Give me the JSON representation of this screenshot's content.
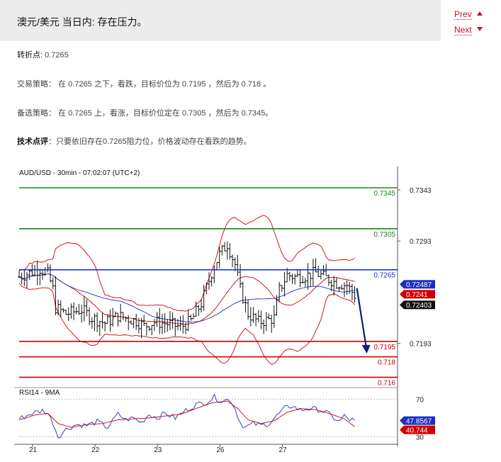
{
  "header": {
    "title": "澳元/美元 当日内: 存在压力。",
    "prev_label": "Prev",
    "next_label": "Next"
  },
  "content": {
    "pivot_label": "转折点:",
    "pivot_value": "0.7265",
    "strategy_label": "交易策略：",
    "strategy_text": "在 0.7265 之下，看跌，目标价位为 0.7195 ，然后为 0.718 。",
    "alt_label": "备选策略：",
    "alt_text": "在 0.7265 上，看涨，目标价位定在 0.7305 ，然后为 0.7345。",
    "comment_label": "技术点评",
    "comment_text": "：只要依旧存在0.7265阻力位，价格波动存在看跌的趋势。"
  },
  "chart_data": [
    {
      "type": "candlestick",
      "title": "AUD/USD - 30min - 07:02:07 (UTC+2)",
      "ylim": [
        0.7152,
        0.7354
      ],
      "y_ticks": [
        "0.7343",
        "0.7293",
        "0.7193"
      ],
      "x_ticks": [
        "21",
        "22",
        "23",
        "26",
        "27"
      ],
      "horizontal_levels": [
        {
          "label": "0.7345",
          "value": 0.7345,
          "color": "#1a8a1a"
        },
        {
          "label": "0.7305",
          "value": 0.7305,
          "color": "#1a8a1a"
        },
        {
          "label": "0.7265",
          "value": 0.7265,
          "color": "#1b2fc4"
        },
        {
          "label": "0.7195",
          "value": 0.7195,
          "color": "#d10000"
        },
        {
          "label": "0.718",
          "value": 0.718,
          "color": "#d10000"
        },
        {
          "label": "0.716",
          "value": 0.716,
          "color": "#d10000"
        }
      ],
      "value_tags": [
        {
          "label": "0.72487",
          "value": 0.72487,
          "color": "#1b2fc4"
        },
        {
          "label": "0.7241",
          "value": 0.72413,
          "color": "#d10000"
        },
        {
          "label": "0.72403",
          "value": 0.72403,
          "color": "#111111"
        }
      ],
      "close_path": [
        [
          0,
          0.7258
        ],
        [
          4,
          0.7262
        ],
        [
          8,
          0.7266
        ],
        [
          11,
          0.7261
        ],
        [
          13,
          0.7246
        ],
        [
          14,
          0.7228
        ],
        [
          18,
          0.7222
        ],
        [
          24,
          0.7226
        ],
        [
          28,
          0.7218
        ],
        [
          33,
          0.7213
        ],
        [
          38,
          0.722
        ],
        [
          45,
          0.7215
        ],
        [
          48,
          0.721
        ],
        [
          52,
          0.7214
        ],
        [
          58,
          0.7212
        ],
        [
          62,
          0.7209
        ],
        [
          66,
          0.7215
        ],
        [
          70,
          0.7232
        ],
        [
          74,
          0.7262
        ],
        [
          77,
          0.728
        ],
        [
          80,
          0.729
        ],
        [
          83,
          0.727
        ],
        [
          85,
          0.7246
        ],
        [
          88,
          0.7222
        ],
        [
          92,
          0.7214
        ],
        [
          96,
          0.7216
        ],
        [
          98,
          0.7218
        ],
        [
          100,
          0.7245
        ],
        [
          103,
          0.726
        ],
        [
          106,
          0.7258
        ],
        [
          110,
          0.7259
        ],
        [
          114,
          0.7262
        ],
        [
          118,
          0.7257
        ],
        [
          122,
          0.7252
        ],
        [
          126,
          0.725
        ],
        [
          129,
          0.724
        ]
      ],
      "forecast": {
        "from": 0.7247,
        "to": 0.7186
      }
    },
    {
      "type": "line",
      "title": "RSI14 - 9MA",
      "ylim": [
        25,
        80
      ],
      "y_ticks": [
        "70",
        "30"
      ],
      "series": [
        {
          "name": "RSI14",
          "color": "#1b2fc4",
          "points": [
            [
              0,
              49
            ],
            [
              5,
              55
            ],
            [
              9,
              58
            ],
            [
              11,
              55
            ],
            [
              13,
              45
            ],
            [
              15,
              30
            ],
            [
              18,
              38
            ],
            [
              22,
              43
            ],
            [
              26,
              42
            ],
            [
              30,
              46
            ],
            [
              34,
              40
            ],
            [
              38,
              54
            ],
            [
              41,
              48
            ],
            [
              44,
              50
            ],
            [
              47,
              45
            ],
            [
              50,
              54
            ],
            [
              53,
              50
            ],
            [
              56,
              55
            ],
            [
              60,
              50
            ],
            [
              64,
              58
            ],
            [
              68,
              64
            ],
            [
              72,
              67
            ],
            [
              75,
              72
            ],
            [
              78,
              68
            ],
            [
              81,
              70
            ],
            [
              83,
              60
            ],
            [
              85,
              45
            ],
            [
              87,
              40
            ],
            [
              90,
              44
            ],
            [
              93,
              42
            ],
            [
              96,
              44
            ],
            [
              99,
              52
            ],
            [
              102,
              60
            ],
            [
              105,
              63
            ],
            [
              108,
              58
            ],
            [
              111,
              60
            ],
            [
              115,
              59
            ],
            [
              118,
              56
            ],
            [
              121,
              50
            ],
            [
              123,
              46
            ],
            [
              125,
              52
            ],
            [
              127,
              48
            ],
            [
              129,
              47.9
            ]
          ]
        },
        {
          "name": "9MA",
          "color": "#d10000",
          "points": [
            [
              0,
              48
            ],
            [
              6,
              53
            ],
            [
              11,
              55
            ],
            [
              15,
              44
            ],
            [
              20,
              40
            ],
            [
              26,
              43
            ],
            [
              32,
              44
            ],
            [
              38,
              48
            ],
            [
              44,
              49
            ],
            [
              50,
              50
            ],
            [
              56,
              52
            ],
            [
              62,
              54
            ],
            [
              68,
              60
            ],
            [
              74,
              66
            ],
            [
              80,
              68
            ],
            [
              84,
              60
            ],
            [
              88,
              48
            ],
            [
              93,
              44
            ],
            [
              98,
              47
            ],
            [
              103,
              56
            ],
            [
              108,
              60
            ],
            [
              114,
              59
            ],
            [
              120,
              54
            ],
            [
              125,
              49
            ],
            [
              129,
              40.7
            ]
          ]
        }
      ],
      "value_tags": [
        {
          "label": "47.8567",
          "value": 47.8567,
          "color": "#1b2fc4"
        },
        {
          "label": "40.744",
          "value": 40.744,
          "color": "#d10000"
        }
      ]
    }
  ]
}
